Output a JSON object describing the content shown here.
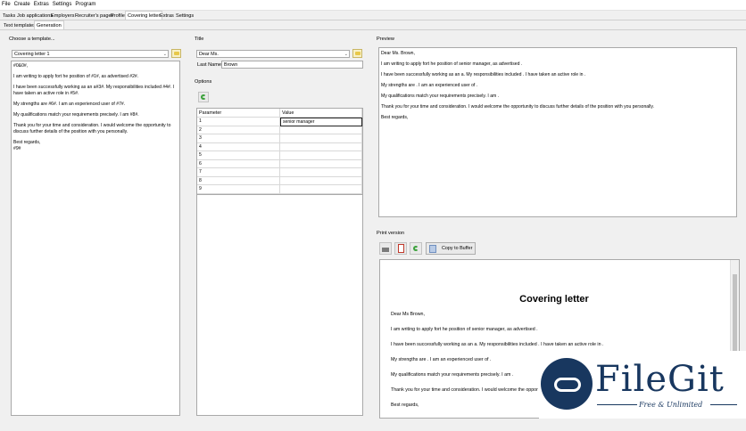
{
  "menu": [
    "File",
    "Create",
    "Extras",
    "Settings",
    "Program"
  ],
  "main_tabs": [
    "Tasks",
    "Job applications",
    "Employers",
    "Recruiter's pages",
    "Profile",
    "Covering letter",
    "Extras",
    "Settings"
  ],
  "sub_tabs": [
    "Text templates",
    "Generation"
  ],
  "template": {
    "label": "Choose a template...",
    "selected": "Covering letter 1",
    "lines": [
      "#0&0#,",
      "I am writing to apply fort he position of #1#, as advertised #2#.",
      "I have been successfully working as an a#3#. My responsibilities included #4#. I have taken an active role in #5#.",
      "My strengths are #6#. I am an experienced user of #7#.",
      "My qualifications match your requirements precisely. I am #8#.",
      "Thank you for your time and consideration. I would welcome the opportunity to discuss further details of the position with you personally.",
      "Best regards,",
      "#9#"
    ]
  },
  "title_section": {
    "label": "Title",
    "selected": "Dear Ms.",
    "last_name_label": "Last Name:",
    "last_name_value": "Brown"
  },
  "options": {
    "label": "Options",
    "columns": [
      "Parameter",
      "Value"
    ],
    "rows": [
      {
        "param": "1",
        "value": "senior manager"
      },
      {
        "param": "2",
        "value": ""
      },
      {
        "param": "3",
        "value": ""
      },
      {
        "param": "4",
        "value": ""
      },
      {
        "param": "5",
        "value": ""
      },
      {
        "param": "6",
        "value": ""
      },
      {
        "param": "7",
        "value": ""
      },
      {
        "param": "8",
        "value": ""
      },
      {
        "param": "9",
        "value": ""
      }
    ]
  },
  "preview": {
    "label": "Preview",
    "lines": [
      "Dear Ms. Brown,",
      "I am writing to apply fort he position of senior manager, as advertised .",
      "I have been successfully working as an a. My responsibilities included . I have taken an active role in .",
      "My strengths are . I am an experienced user of .",
      "My qualifications match your requirements precisely. I am .",
      "Thank you for your time and consideration. I would welcome the opportunity to discuss further details of the position with you personally.",
      "Best regards,"
    ]
  },
  "print_version": {
    "label": "Print version",
    "copy_button": "Copy to Buffer",
    "heading": "Covering letter",
    "lines": [
      "Dear Ms  Brown,",
      "I am writing to apply fort he position of senior manager, as advertised .",
      "I have been successfully working as an a. My responsibilities included . I have taken an active role in .",
      "My strengths are . I am an experienced user of .",
      "My qualifications match your requirements precisely. I am .",
      "Thank you for your time and consideration. I would welcome the oppor",
      "Best regards,"
    ]
  },
  "watermark": {
    "title": "FileGit",
    "subtitle": "Free & Unlimited"
  },
  "colors": {
    "accent_green": "#3aa03a",
    "watermark_navy": "#18375f"
  }
}
